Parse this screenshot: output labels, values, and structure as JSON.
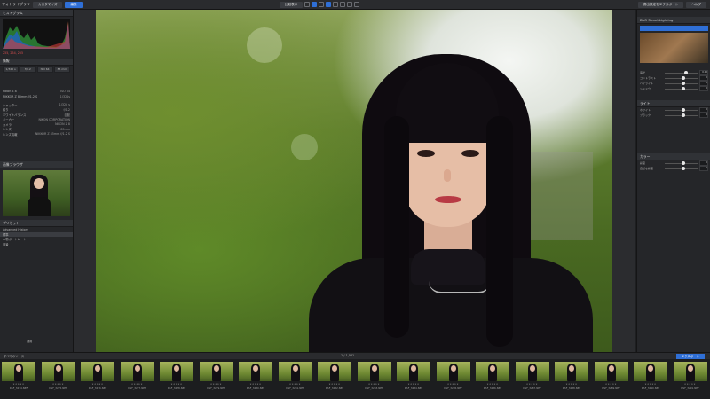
{
  "topbar": {
    "app_title": "フォトライブラリ",
    "tabs": [
      "カスタマイズ",
      "編集"
    ],
    "right_buttons": [
      "書出設定をエクスポート",
      "ヘルプ"
    ],
    "center_label": "比較表示"
  },
  "left_panel": {
    "histogram_header": "ヒストグラム",
    "info_header": "情報",
    "rgb_readout": "255, 254, 255",
    "exif": [
      {
        "label": "Nikon Z 8",
        "value": "ISO 64"
      },
      {
        "label": "NIKKOR Z 85mm f/1.2 S",
        "value": "1/320s"
      },
      {
        "label": "シャッター",
        "value": "1/320 s"
      },
      {
        "label": "絞り",
        "value": "f/1.2"
      },
      {
        "label": "ホワイトバランス",
        "value": "自動"
      },
      {
        "label": "メーカー",
        "value": "NIKON CORPORATION"
      },
      {
        "label": "カメラ",
        "value": "NIKON Z 8"
      },
      {
        "label": "レンズ",
        "value": "85mm"
      },
      {
        "label": "レンズ情報",
        "value": "NIKKOR Z 85mm f/1.2 S"
      }
    ],
    "buttons": [
      "1/320 s",
      "f/1.2",
      "ISO 64",
      "85 mm"
    ],
    "navigator_header": "画像ブラウザ",
    "presets_header": "プリセット",
    "preset_items": [
      "Advanced History",
      "標準",
      "人物ポートレート",
      "風景"
    ],
    "apply_button": "適用"
  },
  "right_panel": {
    "lens_header": "DxO Smart Lighting",
    "items": [
      "露光",
      "コントラスト",
      "ハイライト",
      "シャドウ",
      "ホワイト",
      "ブラック",
      "彩度",
      "自然な彩度"
    ],
    "values": [
      "0.00",
      "0",
      "0",
      "0",
      "0",
      "0",
      "0",
      "0"
    ],
    "section2_header": "ライト",
    "section3_header": "カラー"
  },
  "filmstrip": {
    "toolbar_left": "すべてのソース",
    "count": "1 / 1,061",
    "right_label": "エクスポート",
    "items": [
      "DSF_3274.NEF",
      "DSF_3275.NEF",
      "DSF_3276.NEF",
      "DSF_3277.NEF",
      "DSF_3278.NEF",
      "DSF_3279.NEF",
      "DSF_3280.NEF",
      "DSF_3281.NEF",
      "DSF_3282.NEF",
      "DSF_3283.NEF",
      "DSF_3284.NEF",
      "DSF_3285.NEF",
      "DSF_3286.NEF",
      "DSF_3287.NEF",
      "DSF_3288.NEF",
      "DSF_3289.NEF",
      "DSF_3290.NEF",
      "DSF_3291.NEF"
    ],
    "stars": "★★★★★"
  },
  "colors": {
    "accent": "#2f6fd6",
    "panel": "#252629",
    "bg": "#1e1f21"
  }
}
